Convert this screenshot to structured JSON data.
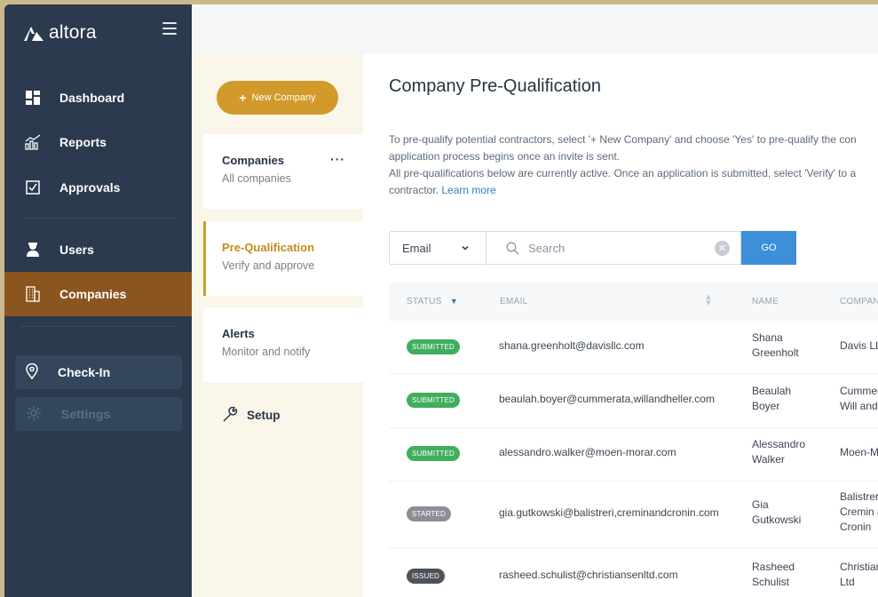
{
  "brand": {
    "name": "altora"
  },
  "sidebar": {
    "items": [
      {
        "label": "Dashboard",
        "icon": "dashboard-icon"
      },
      {
        "label": "Reports",
        "icon": "reports-icon"
      },
      {
        "label": "Approvals",
        "icon": "approvals-icon"
      },
      {
        "label": "Users",
        "icon": "users-icon"
      },
      {
        "label": "Companies",
        "icon": "companies-icon",
        "active": true
      }
    ],
    "checkin_label": "Check-In",
    "settings_label": "Settings"
  },
  "subnav": {
    "new_company_label": "New Company",
    "cards": [
      {
        "title": "Companies",
        "subtitle": "All companies"
      },
      {
        "title": "Pre-Qualification",
        "subtitle": "Verify and approve",
        "active": true
      },
      {
        "title": "Alerts",
        "subtitle": "Monitor and notify"
      }
    ],
    "setup_label": "Setup"
  },
  "main": {
    "title": "Company Pre-Qualification",
    "desc_line1": "To pre-qualify potential contractors, select '+ New Company' and choose 'Yes' to pre-qualify the con",
    "desc_line2": "application process begins once an invite is sent.",
    "desc_line3": "All pre-qualifications below are currently active. Once an application is submitted, select 'Verify' to a",
    "desc_line4_prefix": "contractor.",
    "learn_more": "Learn more",
    "filter": {
      "selected": "Email"
    },
    "search": {
      "placeholder": "Search"
    },
    "go_label": "GO",
    "columns": {
      "status": "STATUS",
      "email": "EMAIL",
      "name": "NAME",
      "company": "COMPANY"
    },
    "rows": [
      {
        "status": "SUBMITTED",
        "email": "shana.greenholt@davisllc.com",
        "name1": "Shana",
        "name2": "Greenholt",
        "company1": "Davis LLC",
        "company2": "",
        "company3": ""
      },
      {
        "status": "SUBMITTED",
        "email": "beaulah.boyer@cummerata,willandheller.com",
        "name1": "Beaulah",
        "name2": "Boyer",
        "company1": "Cummera",
        "company2": "Will and",
        "company3": ""
      },
      {
        "status": "SUBMITTED",
        "email": "alessandro.walker@moen-morar.com",
        "name1": "Alessandro",
        "name2": "Walker",
        "company1": "Moen-Mo",
        "company2": "",
        "company3": ""
      },
      {
        "status": "STARTED",
        "email": "gia.gutkowski@balistreri,creminandcronin.com",
        "name1": "Gia",
        "name2": "Gutkowski",
        "company1": "Balistrer",
        "company2": "Cremin a",
        "company3": "Cronin"
      },
      {
        "status": "ISSUED",
        "email": "rasheed.schulist@christiansenltd.com",
        "name1": "Rasheed",
        "name2": "Schulist",
        "company1": "Christian",
        "company2": "Ltd",
        "company3": ""
      }
    ]
  }
}
